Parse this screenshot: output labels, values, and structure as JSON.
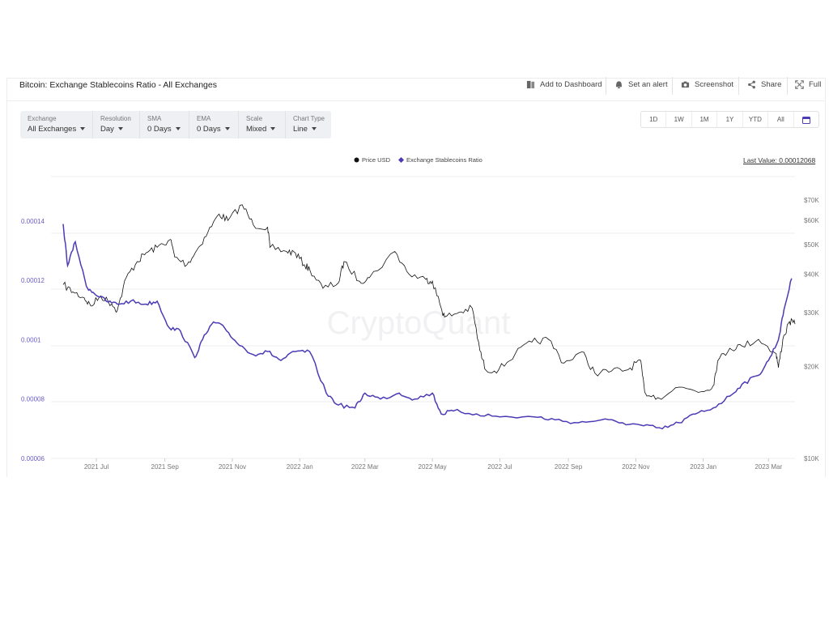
{
  "header": {
    "title": "Bitcoin: Exchange Stablecoins Ratio - All Exchanges",
    "actions": {
      "dashboard": "Add to Dashboard",
      "alert": "Set an alert",
      "screenshot": "Screenshot",
      "share": "Share",
      "full": "Full"
    }
  },
  "controls": [
    {
      "label": "Exchange",
      "value": "All Exchanges"
    },
    {
      "label": "Resolution",
      "value": "Day"
    },
    {
      "label": "SMA",
      "value": "0 Days"
    },
    {
      "label": "EMA",
      "value": "0 Days"
    },
    {
      "label": "Scale",
      "value": "Mixed"
    },
    {
      "label": "Chart Type",
      "value": "Line"
    }
  ],
  "ranges": [
    "1D",
    "1W",
    "1M",
    "1Y",
    "YTD",
    "All"
  ],
  "last_value": "Last Value: 0.00012068",
  "watermark": "CryptoQuant",
  "colors": {
    "price": "#111111",
    "ratio": "#4b3bb5",
    "grid": "#ececec"
  },
  "icons": {
    "dashboard": "dashboard-icon",
    "alert": "bell-icon",
    "screenshot": "camera-icon",
    "share": "share-icon",
    "full": "fullscreen-icon",
    "calendar": "calendar-icon"
  },
  "chart_data": {
    "type": "line",
    "x_ticks": [
      "2021 Jul",
      "2021 Sep",
      "2021 Nov",
      "2022 Jan",
      "2022 Mar",
      "2022 May",
      "2022 Jul",
      "2022 Sep",
      "2022 Nov",
      "2023 Jan",
      "2023 Mar"
    ],
    "y_left_ticks": [
      "0.00014",
      "0.00012",
      "0.0001",
      "0.00008",
      "0.00006"
    ],
    "y_left_values": [
      0.00014,
      0.00012,
      0.0001,
      8e-05,
      6e-05
    ],
    "y_left_range": [
      6e-05,
      0.000155
    ],
    "y_right_ticks": [
      "$70K",
      "$60K",
      "$50K",
      "$40K",
      "$30K",
      "$20K",
      "$10K"
    ],
    "y_right_values": [
      70000,
      60000,
      50000,
      40000,
      30000,
      20000,
      10000
    ],
    "y_right_scale": "log",
    "series": [
      {
        "name": "Price USD",
        "axis": "right",
        "x": [
          "2021-06-01",
          "2021-06-10",
          "2021-06-20",
          "2021-06-26",
          "2021-07-05",
          "2021-07-15",
          "2021-07-20",
          "2021-07-28",
          "2021-08-07",
          "2021-08-15",
          "2021-08-25",
          "2021-09-06",
          "2021-09-10",
          "2021-09-21",
          "2021-09-30",
          "2021-10-10",
          "2021-10-20",
          "2021-10-28",
          "2021-11-10",
          "2021-11-20",
          "2021-12-03",
          "2021-12-05",
          "2021-12-20",
          "2021-12-28",
          "2022-01-05",
          "2022-01-10",
          "2022-01-22",
          "2022-02-05",
          "2022-02-10",
          "2022-02-24",
          "2022-03-05",
          "2022-03-28",
          "2022-04-10",
          "2022-04-25",
          "2022-05-01",
          "2022-05-09",
          "2022-05-12",
          "2022-05-25",
          "2022-06-06",
          "2022-06-13",
          "2022-06-18",
          "2022-06-30",
          "2022-07-15",
          "2022-07-30",
          "2022-08-14",
          "2022-08-28",
          "2022-09-13",
          "2022-09-25",
          "2022-10-10",
          "2022-10-25",
          "2022-11-05",
          "2022-11-09",
          "2022-11-21",
          "2022-12-10",
          "2022-12-31",
          "2023-01-10",
          "2023-01-14",
          "2023-01-25",
          "2023-02-05",
          "2023-02-20",
          "2023-03-08",
          "2023-03-10",
          "2023-03-14",
          "2023-03-20",
          "2023-03-25"
        ],
        "values": [
          37000,
          35000,
          33500,
          31500,
          34000,
          32000,
          30500,
          39000,
          44000,
          47000,
          49000,
          52000,
          45500,
          43000,
          48000,
          55000,
          63000,
          60000,
          67500,
          58000,
          57000,
          49000,
          47500,
          47000,
          43000,
          41500,
          36000,
          37500,
          44000,
          38000,
          39000,
          47500,
          40000,
          38500,
          38000,
          31000,
          29000,
          30000,
          31000,
          22500,
          19500,
          19500,
          22000,
          24000,
          24500,
          20500,
          22300,
          19000,
          19300,
          19500,
          21000,
          16500,
          15800,
          17100,
          16550,
          17300,
          20800,
          22900,
          23300,
          24500,
          22000,
          19800,
          24500,
          28000,
          27500
        ]
      },
      {
        "name": "Exchange Stablecoins Ratio",
        "axis": "left",
        "x": [
          "2021-06-01",
          "2021-06-05",
          "2021-06-12",
          "2021-06-22",
          "2021-06-28",
          "2021-07-10",
          "2021-07-20",
          "2021-08-01",
          "2021-08-15",
          "2021-08-25",
          "2021-09-05",
          "2021-09-15",
          "2021-09-28",
          "2021-10-05",
          "2021-10-15",
          "2021-10-25",
          "2021-11-05",
          "2021-11-20",
          "2021-12-03",
          "2021-12-15",
          "2021-12-28",
          "2022-01-10",
          "2022-01-25",
          "2022-02-05",
          "2022-02-20",
          "2022-03-01",
          "2022-03-15",
          "2022-04-01",
          "2022-04-15",
          "2022-05-01",
          "2022-05-09",
          "2022-05-20",
          "2022-06-10",
          "2022-07-01",
          "2022-08-01",
          "2022-08-20",
          "2022-09-10",
          "2022-10-01",
          "2022-10-20",
          "2022-11-08",
          "2022-11-25",
          "2022-12-10",
          "2022-12-25",
          "2023-01-10",
          "2023-01-25",
          "2023-02-05",
          "2023-02-20",
          "2023-03-01",
          "2023-03-10",
          "2023-03-15",
          "2023-03-22"
        ],
        "values": [
          0.000139,
          0.000125,
          0.000133,
          0.000118,
          0.000116,
          0.000113,
          0.000112,
          0.000113,
          0.000112,
          0.000113,
          0.000104,
          0.000103,
          9.4e-05,
          0.0001,
          0.000106,
          0.000104,
          9.9e-05,
          9.5e-05,
          9.6e-05,
          9.3e-05,
          9.6e-05,
          9.6e-05,
          8.2e-05,
          7.8e-05,
          7.7e-05,
          8.2e-05,
          8e-05,
          8.2e-05,
          8e-05,
          8.2e-05,
          7.5e-05,
          7.6e-05,
          7.5e-05,
          7.4e-05,
          7.4e-05,
          7.3e-05,
          7.2e-05,
          7.3e-05,
          7.2e-05,
          7.1e-05,
          7e-05,
          7.2e-05,
          7.5e-05,
          7.7e-05,
          8.1e-05,
          8.5e-05,
          8.8e-05,
          9.3e-05,
          0.0001,
          0.00011,
          0.00012068
        ]
      }
    ],
    "legend_position": "top-center",
    "grid": true
  }
}
